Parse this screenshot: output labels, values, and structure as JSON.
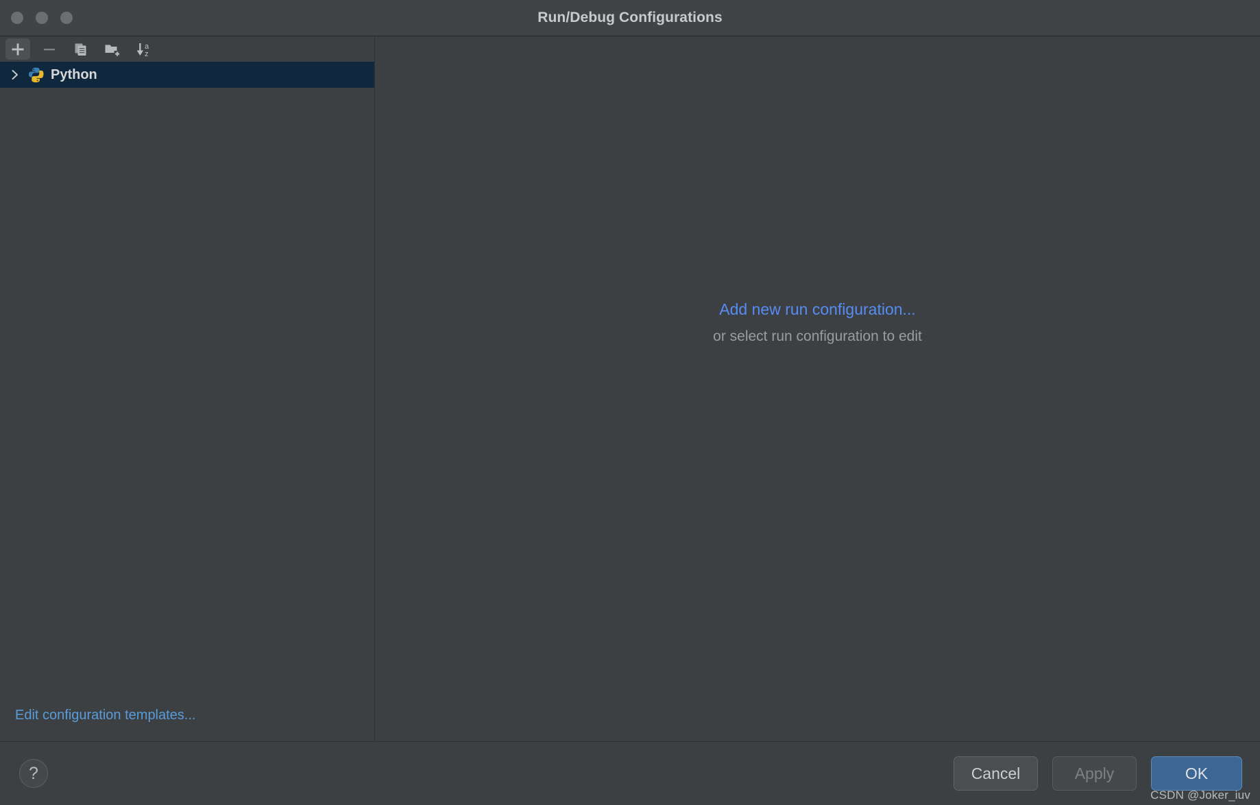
{
  "window": {
    "title": "Run/Debug Configurations",
    "traffic_lights": [
      "close",
      "minimize",
      "zoom"
    ]
  },
  "sidebar": {
    "toolbar": [
      {
        "name": "add-configuration-button",
        "icon": "plus-icon",
        "label": "Add New Configuration",
        "active": true
      },
      {
        "name": "remove-configuration-button",
        "icon": "minus-icon",
        "label": "Remove Configuration",
        "active": false
      },
      {
        "name": "copy-configuration-button",
        "icon": "copy-icon",
        "label": "Copy Configuration",
        "active": false
      },
      {
        "name": "new-folder-button",
        "icon": "folder-plus-icon",
        "label": "Create New Folder",
        "active": false
      },
      {
        "name": "sort-configurations-button",
        "icon": "sort-az-icon",
        "label": "Sort Configurations",
        "active": false
      }
    ],
    "tree": [
      {
        "label": "Python",
        "icon": "python-icon",
        "expanded": false,
        "selected": true
      }
    ],
    "edit_templates_link": "Edit configuration templates...",
    "selection_color": "#10283d"
  },
  "main": {
    "add_new_link": "Add new run configuration...",
    "hint": "or select run configuration to edit",
    "link_color": "#588cf3",
    "hint_color": "#9a9d9f"
  },
  "bottom": {
    "help_label": "?",
    "buttons": [
      {
        "name": "cancel-button",
        "label": "Cancel",
        "style": "secondary",
        "enabled": true
      },
      {
        "name": "apply-button",
        "label": "Apply",
        "style": "disabled",
        "enabled": false
      },
      {
        "name": "ok-button",
        "label": "OK",
        "style": "primary",
        "enabled": true
      }
    ],
    "ok_color": "#3c6694"
  },
  "watermark": "CSDN @Joker_iuv"
}
